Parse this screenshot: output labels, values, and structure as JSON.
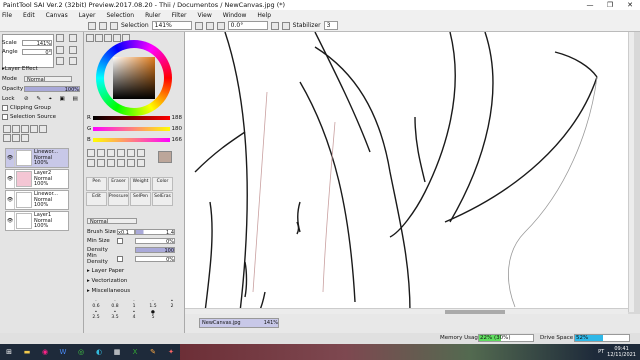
{
  "window": {
    "title": "PaintTool SAI Ver.2 (32bit) Preview.2017.08.20 - Thii / Documentos / NewCanvas.jpg (*)",
    "min": "—",
    "max": "❐",
    "close": "✕"
  },
  "menu": [
    "File",
    "Edit",
    "Canvas",
    "Layer",
    "Selection",
    "Ruler",
    "Filter",
    "View",
    "Window",
    "Help"
  ],
  "toolbar": {
    "selection_label": "Selection",
    "zoom": "141%",
    "angle": "0.0°",
    "stabilizer_label": "Stabilizer",
    "stabilizer_value": "3"
  },
  "left": {
    "scale_label": "Scale",
    "scale_value": "141%",
    "angle_label": "Angle",
    "angle_value": "0°",
    "layer_effect": "Layer Effect",
    "mode_label": "Mode",
    "mode_value": "Normal",
    "opacity_label": "Opacity",
    "opacity_value": "100%",
    "lock_label": "Lock",
    "clipping_group": "Clipping Group",
    "selection_source": "Selection Source",
    "layers": [
      {
        "name": "Linewor...",
        "mode": "Normal",
        "opacity": "100%"
      },
      {
        "name": "Layer2",
        "mode": "Normal",
        "opacity": "100%"
      },
      {
        "name": "Linewor...",
        "mode": "Normal",
        "opacity": "100%"
      },
      {
        "name": "Layer1",
        "mode": "Normal",
        "opacity": "100%"
      }
    ]
  },
  "color": {
    "r_label": "R",
    "r_value": "188",
    "g_label": "G",
    "g_value": "180",
    "b_label": "B",
    "b_value": "166",
    "swatch": "#bca69a"
  },
  "tools": [
    {
      "label": "Pen"
    },
    {
      "label": "Eraser"
    },
    {
      "label": "Weight"
    },
    {
      "label": "Color"
    },
    {
      "label": "Edit"
    },
    {
      "label": "Pressure"
    },
    {
      "label": "SelPen"
    },
    {
      "label": "SelEras"
    }
  ],
  "brush": {
    "mode_value": "Normal",
    "size_label": "Brush Size",
    "size_mult": "x0.1",
    "size_value": "1.4",
    "minsize_label": "Min Size",
    "minsize_value": "0%",
    "density_label": "Density",
    "density_value": "100",
    "mindensity_label": "Min Density",
    "mindensity_value": "0%",
    "layer_paper": "Layer Paper",
    "vectorization": "Vectorization",
    "misc": "Miscellaneous",
    "size_presets": [
      "0.6",
      "0.8",
      "1",
      "1.5",
      "2",
      "2.5",
      "3.5",
      "4",
      "5"
    ]
  },
  "canvas_tab": {
    "name": "NewCanvas.jpg",
    "zoom": "141%"
  },
  "status": {
    "memory_label": "Memory Usage",
    "memory_value": "22% (30%)",
    "drive_label": "Drive Space",
    "drive_value": "52%"
  },
  "taskbar": {
    "time": "09:41",
    "date": "12/11/2021",
    "lang": "PT"
  }
}
